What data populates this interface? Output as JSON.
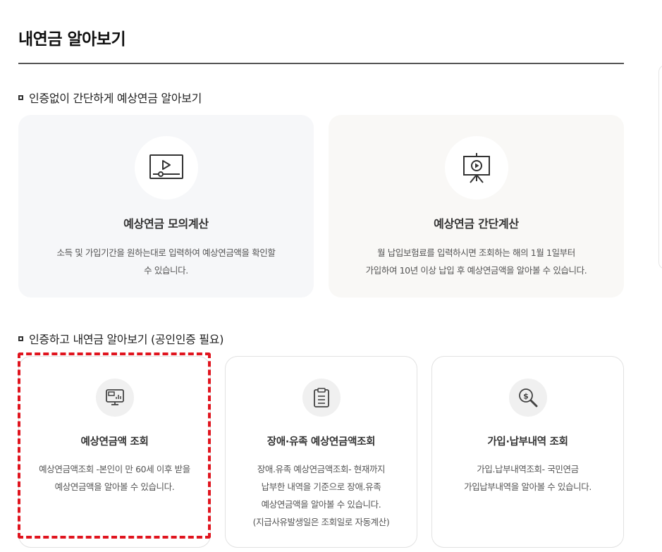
{
  "page": {
    "title": "내연금 알아보기"
  },
  "section1": {
    "title": "인증없이 간단하게 예상연금 알아보기",
    "cards": [
      {
        "title": "예상연금 모의계산",
        "desc_lines": [
          "소득 및 가입기간을 원하는대로 입력하여 예상연금액을 확인할",
          "수 있습니다."
        ],
        "icon": "video-play-icon"
      },
      {
        "title": "예상연금 간단계산",
        "desc_lines": [
          "월 납입보험료를 입력하시면 조회하는 해의 1월 1일부터",
          "가입하여 10년 이상 납입 후 예상연금액을 알아볼 수 있습니다."
        ],
        "icon": "presentation-board-icon"
      }
    ]
  },
  "section2": {
    "title": "인증하고 내연금 알아보기 (공인인증 필요)",
    "cards": [
      {
        "title": "예상연금액 조회",
        "desc_lines": [
          "예상연금액조회 -본인이 만 60세 이후 받을",
          "예상연금액을 알아볼 수 있습니다."
        ],
        "icon": "monitor-chart-icon"
      },
      {
        "title": "장애·유족 예상연금액조회",
        "desc_lines": [
          "장애.유족 예상연금액조회- 현재까지",
          "납부한 내역을 기준으로 장애.유족",
          "예상연금액을 알아볼 수 있습니다.",
          "(지급사유발생일은 조회일로 자동계산)"
        ],
        "icon": "clipboard-icon"
      },
      {
        "title": "가입·납부내역 조회",
        "desc_lines": [
          "가입.납부내역조회- 국민연금",
          "가입납부내역을 알아볼 수 있습니다."
        ],
        "icon": "coin-search-icon"
      }
    ]
  },
  "colors": {
    "highlight": "#e0141e",
    "card_bg_1": "#f6f7f9",
    "card_bg_2": "#f9f8f6"
  }
}
